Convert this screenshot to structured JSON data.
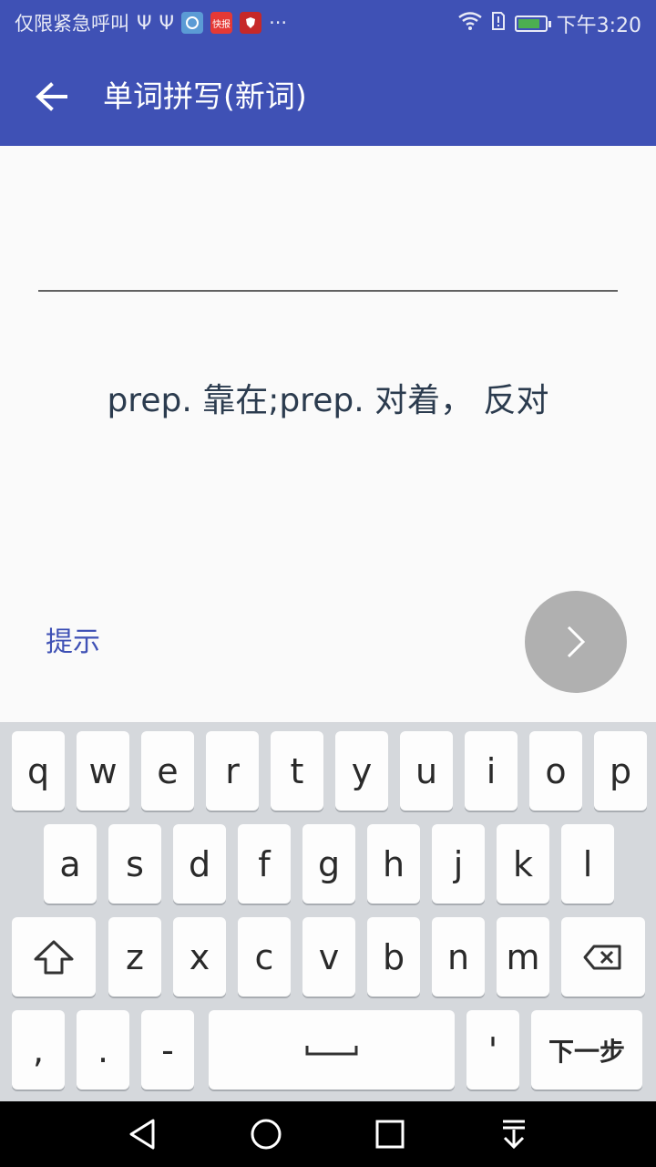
{
  "status_bar": {
    "carrier": "仅限紧急呼叫",
    "app_badges": [
      "快报"
    ],
    "more": "···",
    "time": "下午3:20",
    "battery_level": 0.85
  },
  "app_bar": {
    "title": "单词拼写(新词)"
  },
  "exercise": {
    "answer_value": "",
    "definition": "prep. 靠在;prep. 对着， 反对",
    "hint_label": "提示"
  },
  "keyboard": {
    "row1": [
      "q",
      "w",
      "e",
      "r",
      "t",
      "y",
      "u",
      "i",
      "o",
      "p"
    ],
    "row2": [
      "a",
      "s",
      "d",
      "f",
      "g",
      "h",
      "j",
      "k",
      "l"
    ],
    "row3": [
      "z",
      "x",
      "c",
      "v",
      "b",
      "n",
      "m"
    ],
    "row4": [
      ",",
      ".",
      "-",
      "'"
    ],
    "next_label": "下一步"
  },
  "colors": {
    "primary": "#3f51b5",
    "fab": "#b0b0b0",
    "keyboard_bg": "#d5d8dc"
  }
}
